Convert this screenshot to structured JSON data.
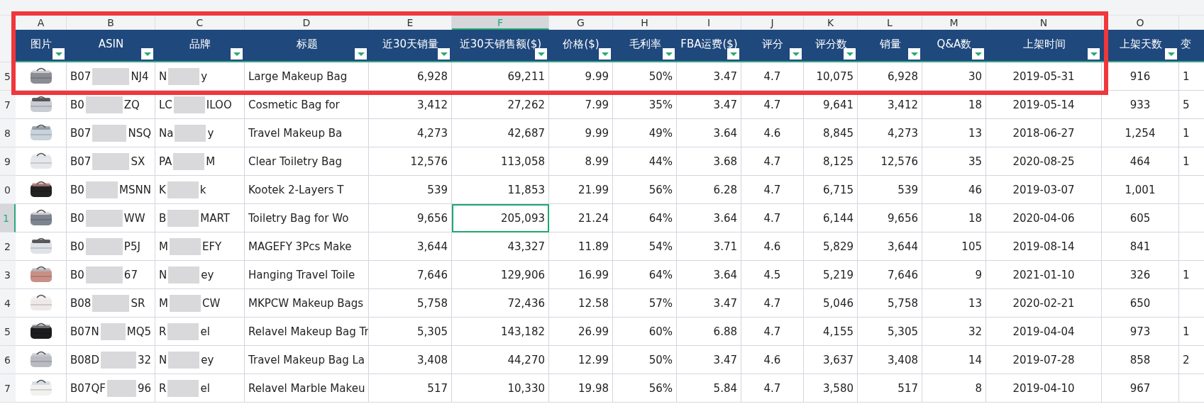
{
  "columns": [
    {
      "letter": "A",
      "header": "图片",
      "selected": false
    },
    {
      "letter": "B",
      "header": "ASIN",
      "selected": false
    },
    {
      "letter": "C",
      "header": "品牌",
      "selected": false
    },
    {
      "letter": "D",
      "header": "标题",
      "selected": false
    },
    {
      "letter": "E",
      "header": "近30天销量",
      "selected": false
    },
    {
      "letter": "F",
      "header": "近30天销售额($)",
      "selected": true
    },
    {
      "letter": "G",
      "header": "价格($)",
      "selected": false
    },
    {
      "letter": "H",
      "header": "毛利率",
      "selected": false
    },
    {
      "letter": "I",
      "header": "FBA运费($)",
      "selected": false
    },
    {
      "letter": "J",
      "header": "评分",
      "selected": false
    },
    {
      "letter": "K",
      "header": "评分数",
      "selected": false
    },
    {
      "letter": "L",
      "header": "销量",
      "selected": false
    },
    {
      "letter": "M",
      "header": "Q&A数",
      "selected": false
    },
    {
      "letter": "N",
      "header": "上架时间",
      "selected": false
    },
    {
      "letter": "O",
      "header": "上架天数",
      "selected": false
    },
    {
      "header": "变"
    }
  ],
  "rows": [
    {
      "label": "5",
      "selected": false,
      "image": {
        "kind": "picture"
      },
      "asin": [
        "B07",
        "NJ4"
      ],
      "brand": [
        "N",
        "y"
      ],
      "title": "Large Makeup Bag",
      "values": [
        "6,928",
        "69,211",
        "9.99",
        "50%",
        "3.47",
        "4.7",
        "10,075",
        "6,928",
        "30",
        "2019-05-31",
        "916",
        "1"
      ]
    },
    {
      "label": "7",
      "selected": false,
      "image": {
        "kind": "picture"
      },
      "asin": [
        "B0",
        "ZQ"
      ],
      "brand": [
        "LC",
        "ILOO"
      ],
      "title": "Cosmetic Bag for",
      "values": [
        "3,412",
        "27,262",
        "7.99",
        "35%",
        "3.47",
        "4.7",
        "9,641",
        "3,412",
        "18",
        "2019-05-14",
        "933",
        "5"
      ]
    },
    {
      "label": "8",
      "selected": false,
      "image": {
        "kind": "picture"
      },
      "asin": [
        "B07",
        "NSQ"
      ],
      "brand": [
        "Na",
        "y"
      ],
      "title": "Travel Makeup Ba",
      "values": [
        "4,273",
        "42,687",
        "9.99",
        "49%",
        "3.64",
        "4.6",
        "8,845",
        "4,273",
        "13",
        "2018-06-27",
        "1,254",
        "1"
      ]
    },
    {
      "label": "9",
      "selected": false,
      "image": {
        "kind": "picture"
      },
      "asin": [
        "B07",
        "SX"
      ],
      "brand": [
        "PA",
        "M"
      ],
      "title": "Clear Toiletry Bag",
      "values": [
        "12,576",
        "113,058",
        "8.99",
        "44%",
        "3.68",
        "4.7",
        "8,125",
        "12,576",
        "35",
        "2020-08-25",
        "464",
        "1"
      ]
    },
    {
      "label": "0",
      "selected": false,
      "image": {
        "kind": "picture"
      },
      "asin": [
        "B0",
        "MSNN"
      ],
      "brand": [
        "K",
        "k"
      ],
      "title": "Kootek 2-Layers T",
      "values": [
        "539",
        "11,853",
        "21.99",
        "56%",
        "6.28",
        "4.7",
        "6,715",
        "539",
        "46",
        "2019-03-07",
        "1,001"
      ]
    },
    {
      "label": "1",
      "selected": true,
      "image": {
        "kind": "picture"
      },
      "asin": [
        "B0",
        "WW"
      ],
      "brand": [
        "B",
        "MART"
      ],
      "title": "Toiletry Bag for Wo",
      "values": [
        "9,656",
        "205,093",
        "21.24",
        "64%",
        "3.64",
        "4.7",
        "6,144",
        "9,656",
        "18",
        "2020-04-06",
        "605"
      ]
    },
    {
      "label": "2",
      "selected": false,
      "image": {
        "kind": "picture"
      },
      "asin": [
        "B0",
        "P5J"
      ],
      "brand": [
        "M",
        "EFY"
      ],
      "title": "MAGEFY 3Pcs Make",
      "values": [
        "3,644",
        "43,327",
        "11.89",
        "54%",
        "3.71",
        "4.6",
        "5,829",
        "3,644",
        "105",
        "2019-08-14",
        "841"
      ]
    },
    {
      "label": "3",
      "selected": false,
      "image": {
        "kind": "picture"
      },
      "asin": [
        "B0",
        "67"
      ],
      "brand": [
        "N",
        "ey"
      ],
      "title": "Hanging Travel Toile",
      "values": [
        "7,646",
        "129,906",
        "16.99",
        "64%",
        "3.64",
        "4.5",
        "5,219",
        "7,646",
        "9",
        "2021-01-10",
        "326",
        "1"
      ]
    },
    {
      "label": "4",
      "selected": false,
      "image": {
        "kind": "picture"
      },
      "asin": [
        "B08",
        "SR"
      ],
      "brand": [
        "M",
        "CW"
      ],
      "title": "MKPCW Makeup Bags",
      "values": [
        "5,758",
        "72,436",
        "12.58",
        "57%",
        "3.47",
        "4.7",
        "5,046",
        "5,758",
        "13",
        "2020-02-21",
        "650"
      ]
    },
    {
      "label": "5",
      "selected": false,
      "image": {
        "kind": "picture"
      },
      "asin": [
        "B07N",
        "MQ5"
      ],
      "brand": [
        "R",
        "el"
      ],
      "title": "Relavel Makeup Bag Tr",
      "values": [
        "5,305",
        "143,182",
        "26.99",
        "60%",
        "6.88",
        "4.7",
        "4,155",
        "5,305",
        "32",
        "2019-04-04",
        "973",
        "1"
      ]
    },
    {
      "label": "6",
      "selected": false,
      "image": {
        "kind": "picture"
      },
      "asin": [
        "B08D",
        "32"
      ],
      "brand": [
        "N",
        "ey"
      ],
      "title": "Travel Makeup Bag La",
      "values": [
        "3,408",
        "44,270",
        "12.99",
        "50%",
        "3.47",
        "4.6",
        "3,637",
        "3,408",
        "14",
        "2019-07-28",
        "858",
        "2"
      ]
    },
    {
      "label": "7",
      "selected": false,
      "image": {
        "kind": "picture"
      },
      "asin": [
        "B07QF",
        "96"
      ],
      "brand": [
        "R",
        "el"
      ],
      "title": "Relavel Marble Makeu",
      "values": [
        "517",
        "10,330",
        "19.98",
        "56%",
        "5.84",
        "4.7",
        "3,580",
        "517",
        "8",
        "2019-04-10",
        "967"
      ]
    }
  ]
}
